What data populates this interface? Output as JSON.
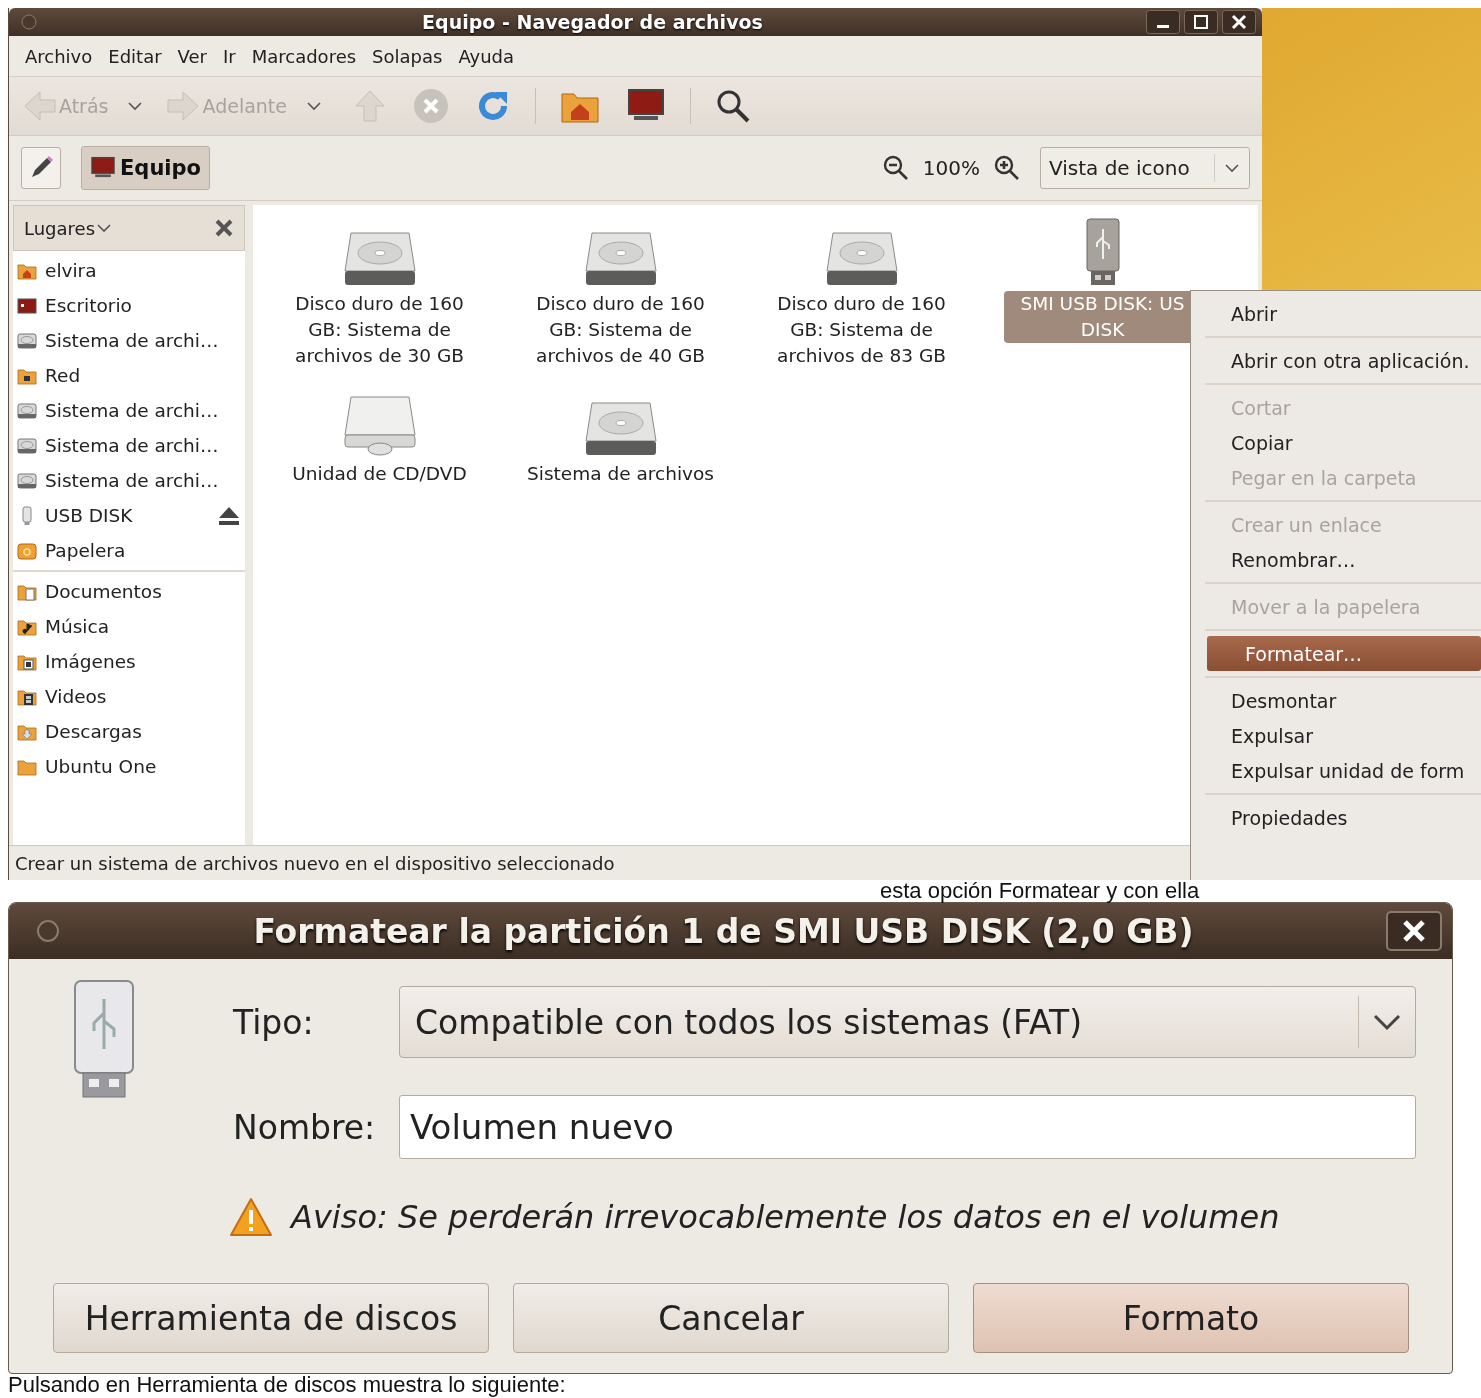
{
  "file_manager": {
    "title": "Equipo - Navegador de archivos",
    "menu": [
      "Archivo",
      "Editar",
      "Ver",
      "Ir",
      "Marcadores",
      "Solapas",
      "Ayuda"
    ],
    "toolbar": [
      [
        {
          "kind": "back",
          "label": "Atrás",
          "disabled": true
        },
        {
          "kind": "forward",
          "label": "Adelante",
          "disabled": true
        },
        {
          "kind": "up",
          "disabled": true
        },
        {
          "kind": "stop",
          "disabled": true
        },
        {
          "kind": "reload",
          "disabled": false
        }
      ],
      [
        {
          "kind": "home",
          "disabled": false
        },
        {
          "kind": "computer",
          "disabled": false
        }
      ],
      [
        {
          "kind": "search",
          "disabled": false
        }
      ]
    ],
    "location": {
      "path_button": "Equipo",
      "zoom": "100%",
      "view": "Vista de icono"
    },
    "sidebar": {
      "title": "Lugares",
      "groups": [
        [
          {
            "label": "elvira",
            "kind": "home",
            "ejectable": false
          },
          {
            "label": "Escritorio",
            "kind": "desktop",
            "ejectable": false
          },
          {
            "label": "Sistema de archi…",
            "kind": "drive",
            "ejectable": false
          },
          {
            "label": "Red",
            "kind": "network",
            "ejectable": false
          },
          {
            "label": "Sistema de archi…",
            "kind": "drive",
            "ejectable": false
          },
          {
            "label": "Sistema de archi…",
            "kind": "drive",
            "ejectable": false
          },
          {
            "label": "Sistema de archi…",
            "kind": "drive",
            "ejectable": false
          },
          {
            "label": "USB DISK",
            "kind": "usb",
            "ejectable": true
          },
          {
            "label": "Papelera",
            "kind": "trash",
            "ejectable": false
          }
        ],
        [
          {
            "label": "Documentos",
            "kind": "documents",
            "ejectable": false
          },
          {
            "label": "Música",
            "kind": "music",
            "ejectable": false
          },
          {
            "label": "Imágenes",
            "kind": "pictures",
            "ejectable": false
          },
          {
            "label": "Videos",
            "kind": "videos",
            "ejectable": false
          },
          {
            "label": "Descargas",
            "kind": "downloads",
            "ejectable": false
          },
          {
            "label": "Ubuntu One",
            "kind": "folder",
            "ejectable": false
          }
        ]
      ]
    },
    "items": [
      {
        "label": "Disco duro de 160 GB: Sistema de archivos de 30 GB",
        "kind": "drive",
        "selected": false
      },
      {
        "label": "Disco duro de 160 GB: Sistema de archivos de 40 GB",
        "kind": "drive",
        "selected": false
      },
      {
        "label": "Disco duro de 160 GB: Sistema de archivos de 83 GB",
        "kind": "drive",
        "selected": false
      },
      {
        "label": "SMI USB DISK: US DISK",
        "kind": "usb",
        "selected": true
      },
      {
        "label": "Unidad de CD/DVD",
        "kind": "cdrom",
        "selected": false
      },
      {
        "label": "Sistema de archivos",
        "kind": "drive",
        "selected": false
      }
    ],
    "status": "Crear un sistema de archivos nuevo en el dispositivo seleccionado"
  },
  "context_menu": {
    "groups": [
      [
        {
          "label": "Abrir",
          "disabled": false,
          "selected": false
        }
      ],
      [
        {
          "label": "Abrir con otra aplicación.",
          "disabled": false,
          "selected": false
        }
      ],
      [
        {
          "label": "Cortar",
          "disabled": true,
          "selected": false
        },
        {
          "label": "Copiar",
          "disabled": false,
          "selected": false
        },
        {
          "label": "Pegar en la carpeta",
          "disabled": true,
          "selected": false
        }
      ],
      [
        {
          "label": "Crear un enlace",
          "disabled": true,
          "selected": false
        },
        {
          "label": "Renombrar…",
          "disabled": false,
          "selected": false
        }
      ],
      [
        {
          "label": "Mover a la papelera",
          "disabled": true,
          "selected": false
        }
      ],
      [
        {
          "label": "Formatear…",
          "disabled": false,
          "selected": true
        }
      ],
      [
        {
          "label": "Desmontar",
          "disabled": false,
          "selected": false
        },
        {
          "label": "Expulsar",
          "disabled": false,
          "selected": false
        },
        {
          "label": "Expulsar unidad de form",
          "disabled": false,
          "selected": false
        }
      ],
      [
        {
          "label": "Propiedades",
          "disabled": false,
          "selected": false
        }
      ]
    ]
  },
  "caption_1": "esta opción Formatear y con ella",
  "format_dialog": {
    "title": "Formatear la partición 1 de SMI USB DISK (2,0 GB)",
    "type_label": "Tipo:",
    "type_value": "Compatible con todos los sistemas (FAT)",
    "name_label": "Nombre:",
    "name_value": "Volumen nuevo",
    "warning": "Aviso: Se perderán irrevocablemente los datos en el volumen",
    "buttons": [
      {
        "label": "Herramienta de discos",
        "default": false
      },
      {
        "label": "Cancelar",
        "default": false
      },
      {
        "label": "Formato",
        "default": true
      }
    ]
  },
  "caption_2": "Pulsando en Herramienta de discos muestra lo siguiente:"
}
